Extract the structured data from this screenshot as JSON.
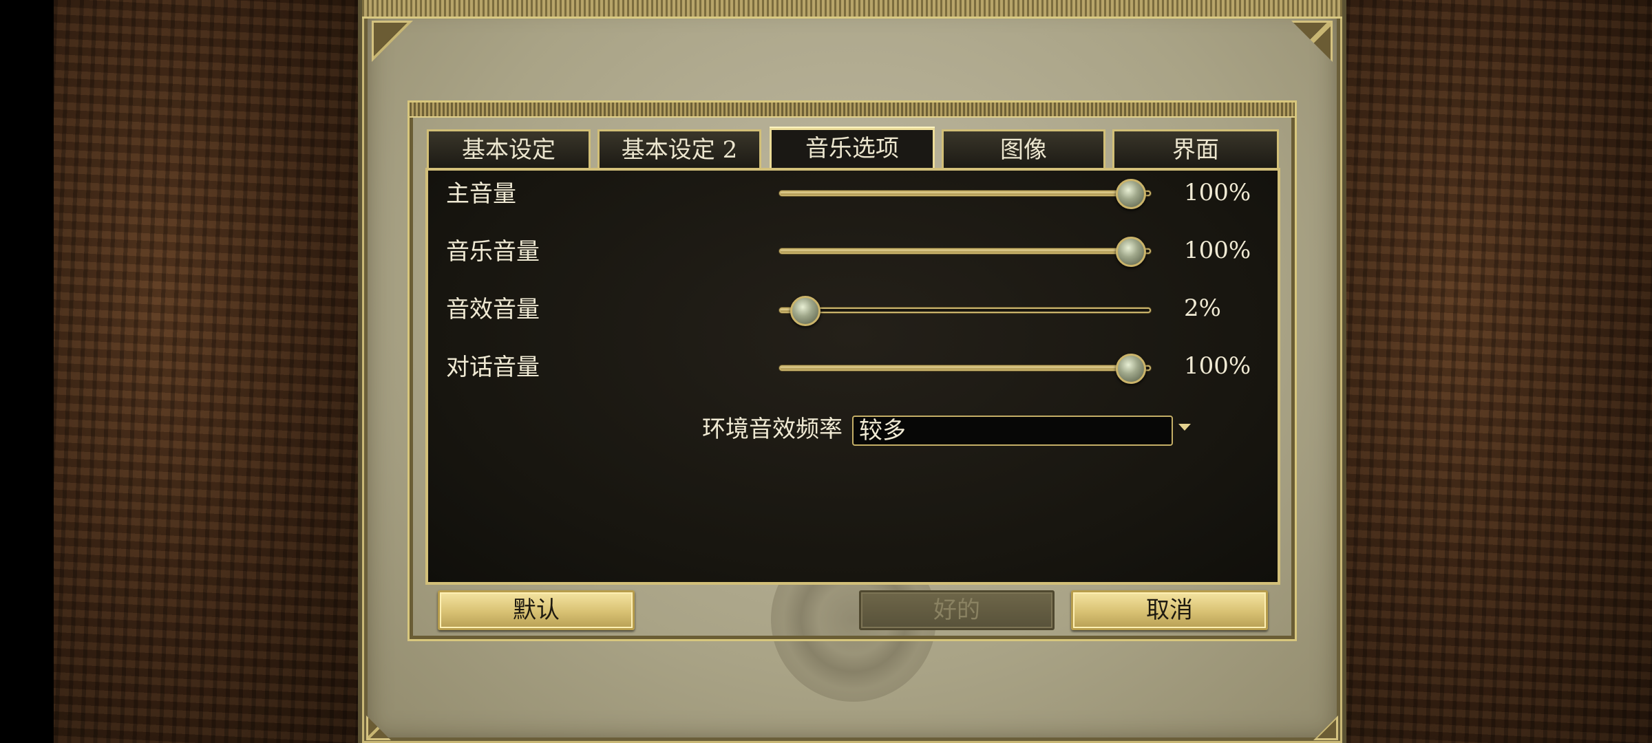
{
  "tabs": [
    {
      "label": "基本设定"
    },
    {
      "label": "基本设定 2"
    },
    {
      "label": "音乐选项",
      "active": true
    },
    {
      "label": "图像"
    },
    {
      "label": "界面"
    }
  ],
  "sliders": [
    {
      "label": "主音量",
      "value": 100,
      "display": "100%"
    },
    {
      "label": "音乐音量",
      "value": 100,
      "display": "100%"
    },
    {
      "label": "音效音量",
      "value": 2,
      "display": "2%"
    },
    {
      "label": "对话音量",
      "value": 100,
      "display": "100%"
    }
  ],
  "ambient": {
    "label": "环境音效频率",
    "selected": "较多"
  },
  "buttons": {
    "default": "默认",
    "ok": "好的",
    "ok_disabled": true,
    "cancel": "取消"
  },
  "colors": {
    "gold": "#d3c07a",
    "panel_bg": "#17150f",
    "text": "#f0ead4"
  }
}
